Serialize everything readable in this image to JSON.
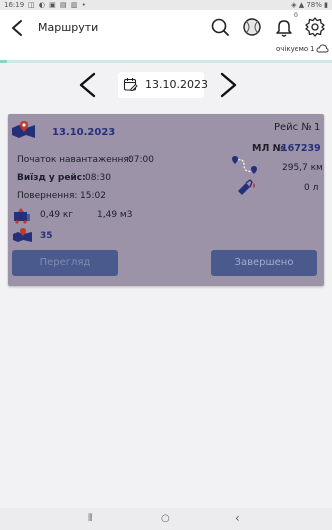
{
  "status_bar": {
    "time": "16:19",
    "left_icons": "◫ ◐ ▣ ▤ ▥ •",
    "right_text": "◈ ▲ 78% ▮"
  },
  "header": {
    "title": "Маршрути",
    "notification_count": "0"
  },
  "sync": {
    "pending_label": "очікуємо",
    "pending_count": "1"
  },
  "progress": {
    "value": 0.02
  },
  "date_nav": {
    "date": "13.10.2023"
  },
  "trip_card": {
    "date": "13.10.2023",
    "trip_label": "Рейс №",
    "trip_number": "1",
    "waybill_label": "МЛ №",
    "waybill_number": "167239",
    "loading_start_label": "Початок навантаження:",
    "loading_start_time": "07:00",
    "departure_label": "Виїзд у рейс:",
    "departure_time": "08:30",
    "return_label": "Повернення:",
    "return_time": "15:02",
    "distance": "295,7 км",
    "fuel": "0 л",
    "weight": "0,49 кг",
    "volume": "1,49 м3",
    "points_count": "35",
    "view_button": "Перегляд",
    "status_button": "Завершено"
  },
  "nav_bar": {
    "recents": "⦀",
    "home": "○",
    "back": "‹"
  },
  "colors": {
    "card_background": "#9c93a8",
    "button_background": "#4a5a8c",
    "accent_text": "#26307a",
    "progress_fill": "#8fd1bf"
  },
  "icons": {
    "header_back": "arrow-left-icon",
    "search": "search-icon",
    "tennis_ball": "tennis-ball-icon",
    "bell": "bell-icon",
    "settings": "gear-icon",
    "cloud": "cloud-sync-icon",
    "calendar": "calendar-edit-icon",
    "map": "map-pin-icon",
    "route": "route-icon",
    "fuel_pump": "fuel-pump-icon",
    "cargo": "cargo-icon",
    "points": "map-points-icon"
  }
}
